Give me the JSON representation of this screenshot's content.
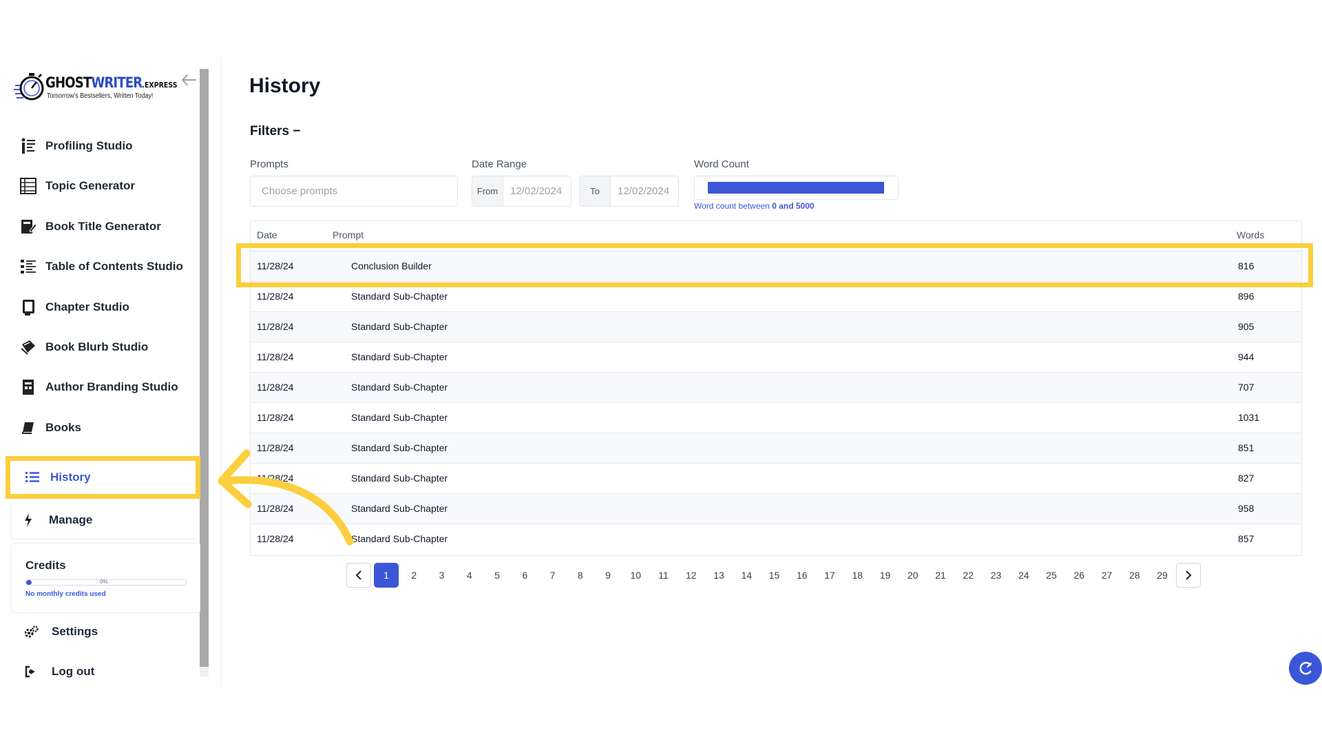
{
  "brand": {
    "name_part1": "GHOST",
    "name_part2": "WRITER",
    "name_part3": ".EXPRESS",
    "tagline": "Tomorrow's Bestsellers, Written Today!"
  },
  "sidebar": {
    "items": [
      {
        "label": "Profiling Studio",
        "icon": "profiling-icon"
      },
      {
        "label": "Topic Generator",
        "icon": "topic-icon"
      },
      {
        "label": "Book Title Generator",
        "icon": "title-icon"
      },
      {
        "label": "Table of Contents Studio",
        "icon": "toc-icon"
      },
      {
        "label": "Chapter Studio",
        "icon": "chapter-icon"
      },
      {
        "label": "Book Blurb Studio",
        "icon": "blurb-icon"
      },
      {
        "label": "Author Branding Studio",
        "icon": "branding-icon"
      },
      {
        "label": "Books",
        "icon": "book-icon"
      }
    ],
    "history_label": "History",
    "manage_label": "Manage",
    "credits": {
      "title": "Credits",
      "percent_label": "0%",
      "percent_value": 0,
      "note": "No monthly credits used"
    },
    "settings_label": "Settings",
    "logout_label": "Log out"
  },
  "main": {
    "title": "History",
    "filters_label": "Filters −",
    "filters": {
      "prompts_label": "Prompts",
      "prompts_placeholder": "Choose prompts",
      "date_range_label": "Date Range",
      "from_label": "From",
      "from_value": "12/02/2024",
      "to_label": "To",
      "to_value": "12/02/2024",
      "word_count_label": "Word Count",
      "word_count_note_prefix": "Word count between ",
      "word_count_note_range": "0 and 5000",
      "word_count_min": 0,
      "word_count_max": 5000
    },
    "table": {
      "headers": {
        "date": "Date",
        "prompt": "Prompt",
        "words": "Words"
      },
      "rows": [
        {
          "date": "11/28/24",
          "prompt": "Conclusion Builder",
          "words": "816"
        },
        {
          "date": "11/28/24",
          "prompt": "Standard Sub-Chapter",
          "words": "896"
        },
        {
          "date": "11/28/24",
          "prompt": "Standard Sub-Chapter",
          "words": "905"
        },
        {
          "date": "11/28/24",
          "prompt": "Standard Sub-Chapter",
          "words": "944"
        },
        {
          "date": "11/28/24",
          "prompt": "Standard Sub-Chapter",
          "words": "707"
        },
        {
          "date": "11/28/24",
          "prompt": "Standard Sub-Chapter",
          "words": "1031"
        },
        {
          "date": "11/28/24",
          "prompt": "Standard Sub-Chapter",
          "words": "851"
        },
        {
          "date": "11/28/24",
          "prompt": "Standard Sub-Chapter",
          "words": "827"
        },
        {
          "date": "11/28/24",
          "prompt": "Standard Sub-Chapter",
          "words": "958"
        },
        {
          "date": "11/28/24",
          "prompt": "Standard Sub-Chapter",
          "words": "857"
        }
      ]
    },
    "pagination": {
      "current": "1",
      "pages": [
        "1",
        "2",
        "3",
        "4",
        "5",
        "6",
        "7",
        "8",
        "9",
        "10",
        "11",
        "12",
        "13",
        "14",
        "15",
        "16",
        "17",
        "18",
        "19",
        "20",
        "21",
        "22",
        "23",
        "24",
        "25",
        "26",
        "27",
        "28",
        "29"
      ]
    }
  },
  "colors": {
    "accent": "#3b57d8",
    "highlight": "#fbcf3d"
  }
}
